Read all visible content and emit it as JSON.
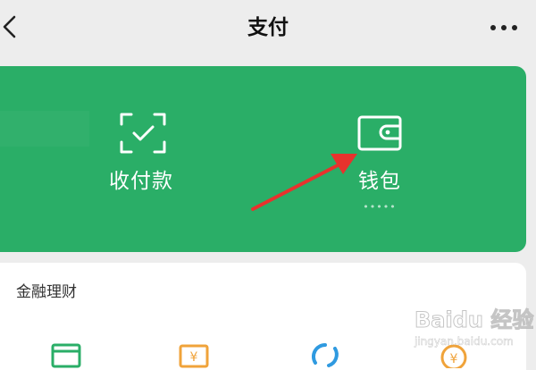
{
  "nav": {
    "back_icon": "chevron-left-icon",
    "title": "支付",
    "more_icon": "more-dots-icon"
  },
  "green_card": {
    "background": "#2aae67",
    "collect": {
      "label": "收付款",
      "icon": "scan-check-icon"
    },
    "wallet": {
      "label": "钱包",
      "icon": "wallet-icon",
      "masked_balance": "•••••"
    }
  },
  "annotation": {
    "arrow_color": "#e8322d",
    "points_to": "wallet"
  },
  "finance": {
    "heading": "金融理财",
    "items": [
      {
        "icon": "card-icon",
        "color": "#2aae67"
      },
      {
        "icon": "money-icon",
        "color": "#f0a33a"
      },
      {
        "icon": "refresh-icon",
        "color": "#2f9ae0"
      },
      {
        "icon": "coin-icon",
        "color": "#f0a33a"
      }
    ]
  },
  "watermark": {
    "text": "Baidu 经验",
    "subtext": "jingyan.baidu.com"
  }
}
